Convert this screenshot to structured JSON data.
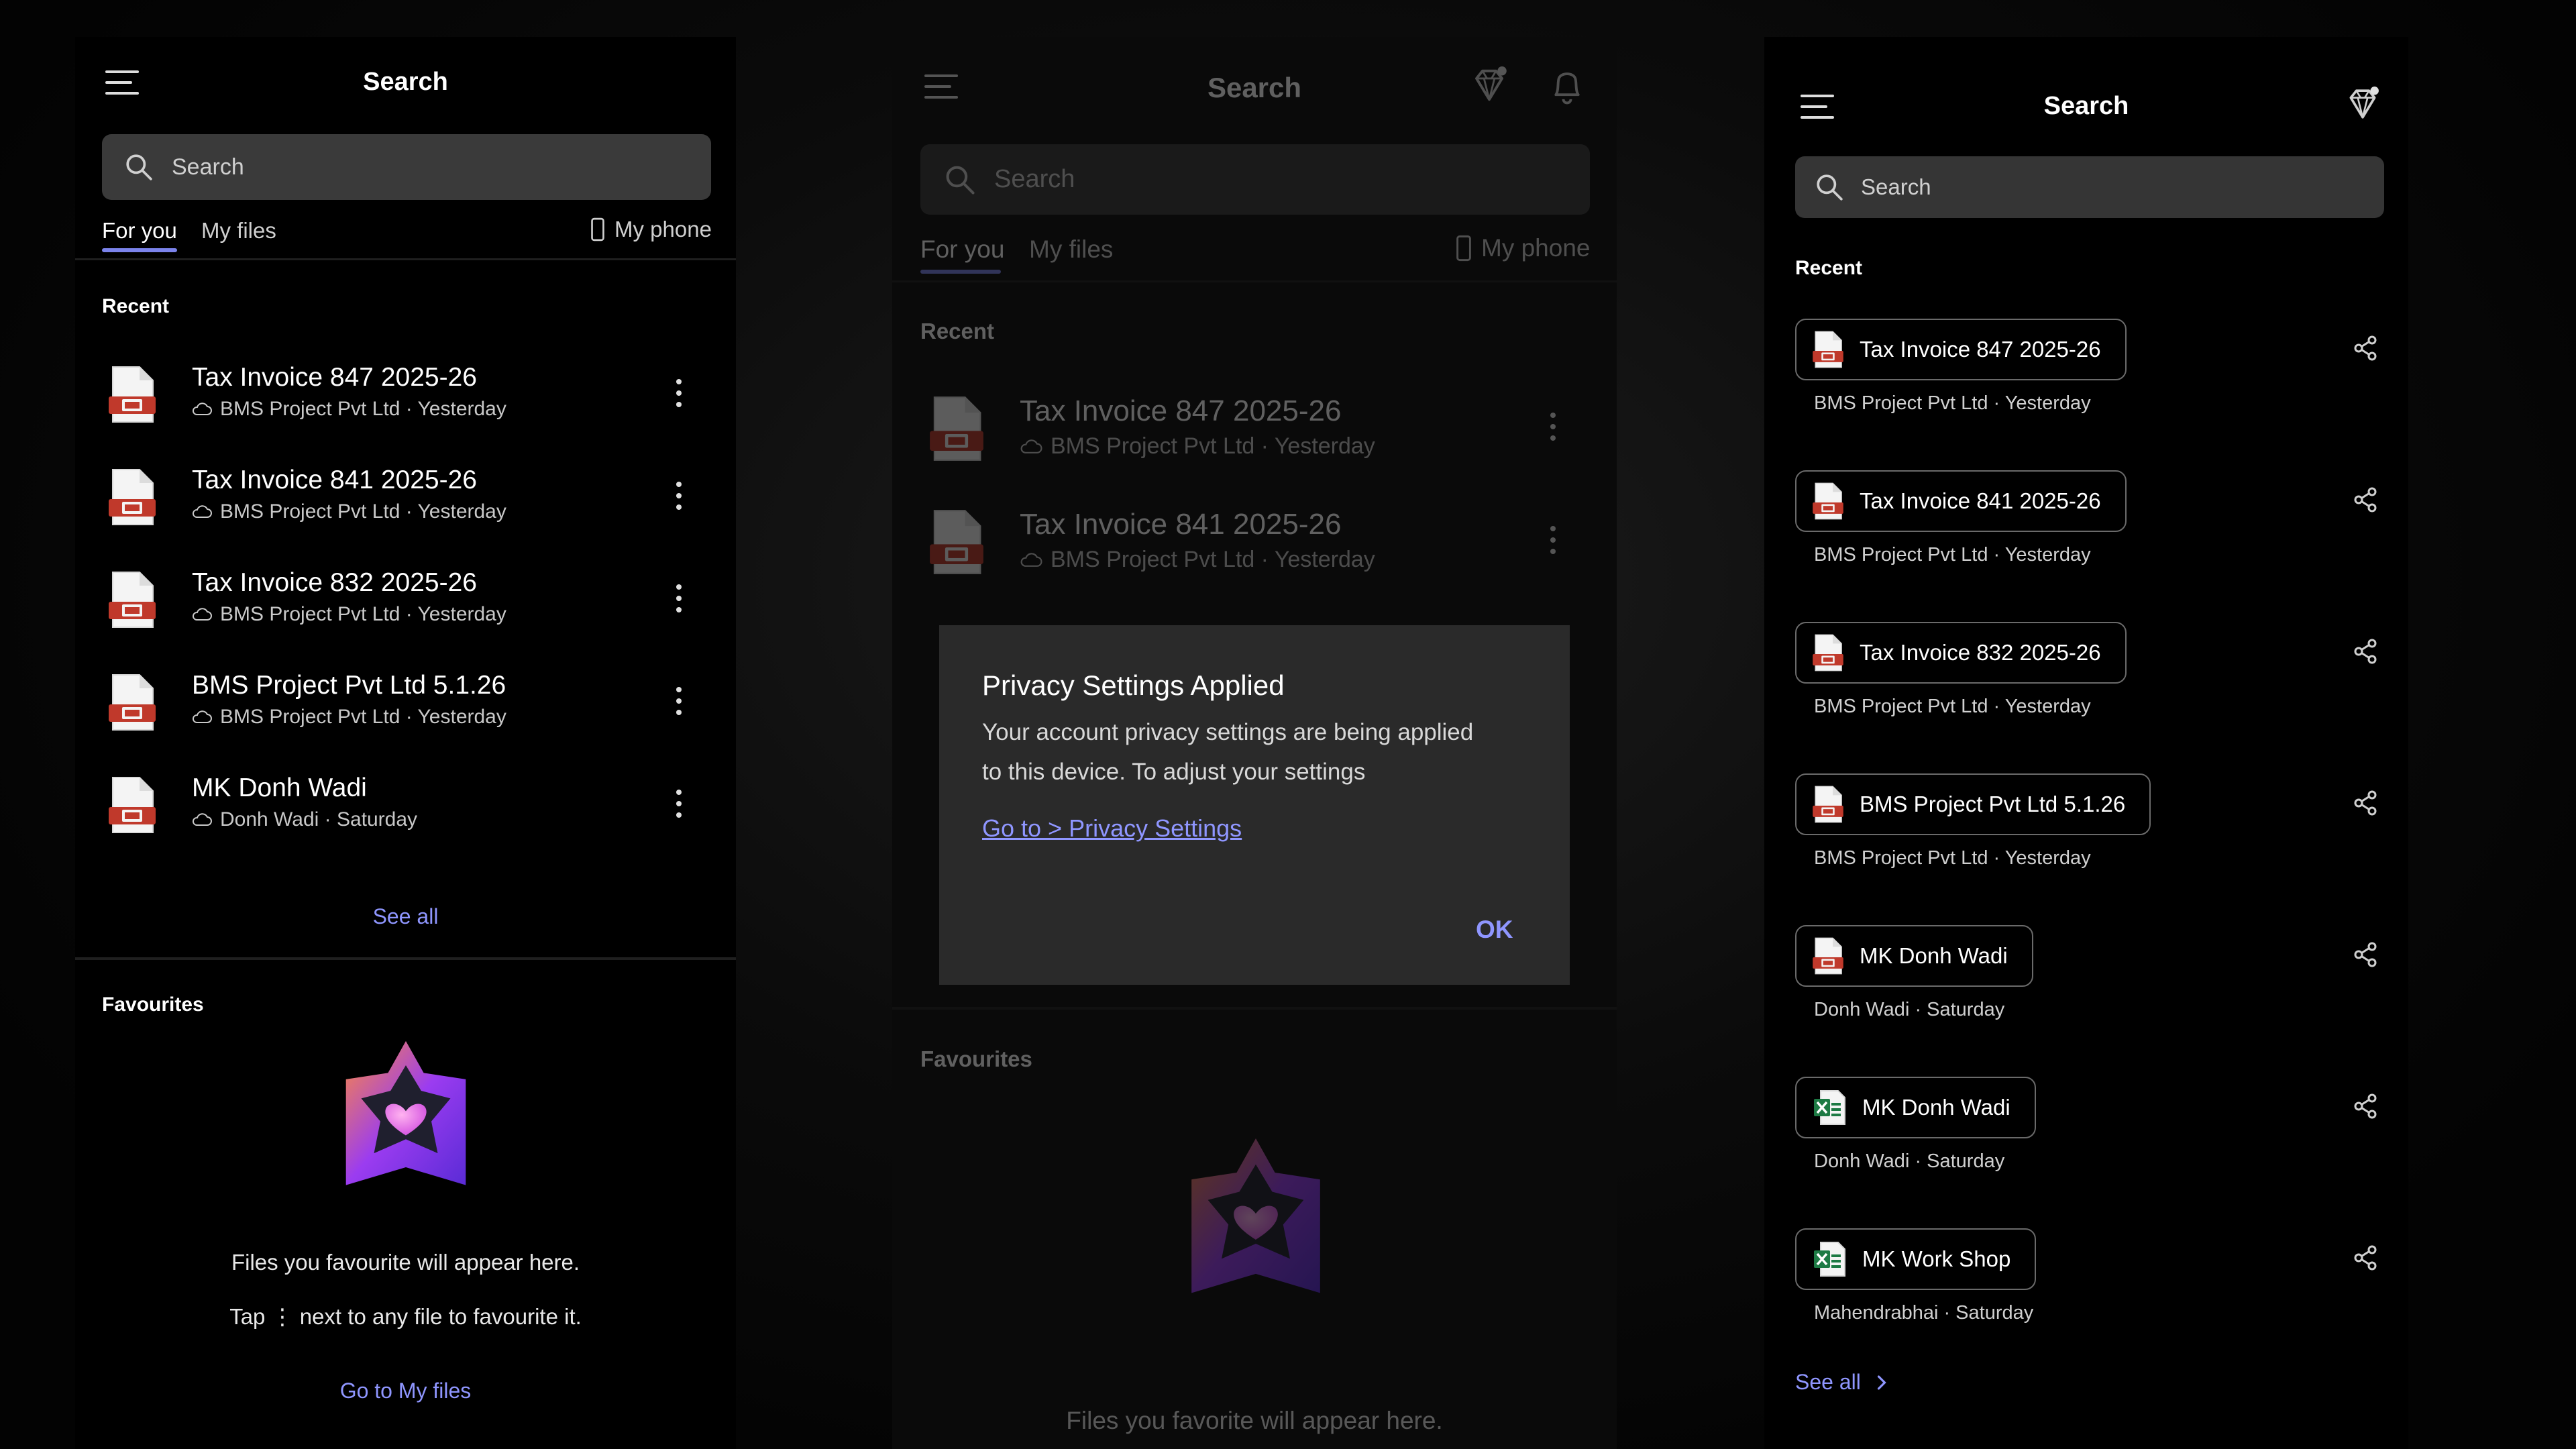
{
  "colors": {
    "accent": "#7b83eb",
    "link": "#8f96ff",
    "pdf_red": "#c0392b",
    "excel_green": "#1d7a44"
  },
  "left": {
    "title": "Search",
    "search_placeholder": "Search",
    "tabs": {
      "for_you": "For you",
      "my_files": "My files",
      "my_phone": "My phone"
    },
    "recent_label": "Recent",
    "files": [
      {
        "name": "Tax Invoice 847 2025-26",
        "sub": "BMS Project Pvt Ltd · Yesterday"
      },
      {
        "name": "Tax Invoice 841 2025-26",
        "sub": "BMS Project Pvt Ltd · Yesterday"
      },
      {
        "name": "Tax Invoice 832 2025-26",
        "sub": "BMS Project Pvt Ltd · Yesterday"
      },
      {
        "name": "BMS Project Pvt Ltd 5.1.26",
        "sub": "BMS Project Pvt Ltd · Yesterday"
      },
      {
        "name": "MK Donh Wadi",
        "sub": "Donh Wadi · Saturday"
      }
    ],
    "see_all": "See all",
    "favourites_label": "Favourites",
    "fav_line1": "Files you favourite will appear here.",
    "fav_line2": "Tap ⋮ next to any file to favourite it.",
    "go_to_my_files": "Go to My files"
  },
  "middle": {
    "title": "Search",
    "search_placeholder": "Search",
    "tabs": {
      "for_you": "For you",
      "my_files": "My files",
      "my_phone": "My phone"
    },
    "recent_label": "Recent",
    "files": [
      {
        "name": "Tax Invoice 847 2025-26",
        "sub": "BMS Project Pvt Ltd · Yesterday"
      },
      {
        "name": "Tax Invoice 841 2025-26",
        "sub": "BMS Project Pvt Ltd · Yesterday"
      }
    ],
    "favourites_label": "Favourites",
    "fav_line1": "Files you favorite will appear here.",
    "dialog": {
      "title": "Privacy Settings Applied",
      "body_line1": "Your account privacy settings are being applied",
      "body_line2": "to this device. To adjust your settings",
      "link": "Go to > Privacy Settings",
      "ok": "OK"
    }
  },
  "right": {
    "title": "Search",
    "search_placeholder": "Search",
    "recent_label": "Recent",
    "items": [
      {
        "name": "Tax Invoice 847 2025-26",
        "sub": "BMS Project Pvt Ltd · Yesterday",
        "icon": "pdf"
      },
      {
        "name": "Tax Invoice 841 2025-26",
        "sub": "BMS Project Pvt Ltd · Yesterday",
        "icon": "pdf"
      },
      {
        "name": "Tax Invoice 832 2025-26",
        "sub": "BMS Project Pvt Ltd · Yesterday",
        "icon": "pdf"
      },
      {
        "name": "BMS Project Pvt Ltd 5.1.26",
        "sub": "BMS Project Pvt Ltd · Yesterday",
        "icon": "pdf"
      },
      {
        "name": "MK Donh Wadi",
        "sub": "Donh Wadi · Saturday",
        "icon": "pdf"
      },
      {
        "name": "MK Donh Wadi",
        "sub": "Donh Wadi · Saturday",
        "icon": "excel"
      },
      {
        "name": "MK Work Shop",
        "sub": "Mahendrabhai · Saturday",
        "icon": "excel"
      }
    ],
    "see_all": "See all"
  }
}
